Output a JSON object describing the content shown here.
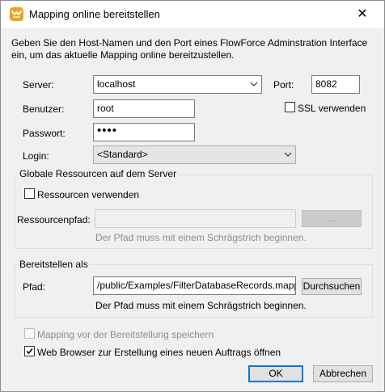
{
  "window": {
    "title": "Mapping online bereitstellen",
    "close_glyph": "✕",
    "icon": "mapforce-app-icon"
  },
  "intro": "Geben Sie den Host-Namen und den Port eines FlowForce Adminstration Interface ein, um das aktuelle Mapping online bereitzustellen.",
  "server": {
    "label": "Server:",
    "value": "localhost",
    "port_label": "Port:",
    "port_value": "8082"
  },
  "user": {
    "label": "Benutzer:",
    "value": "root",
    "ssl_label": "SSL verwenden",
    "ssl_checked": false
  },
  "password": {
    "label": "Passwort:",
    "masked_value": "••••"
  },
  "login": {
    "label": "Login:",
    "selected": "<Standard>"
  },
  "global_resources": {
    "title": "Globale Ressourcen auf dem Server",
    "use_label": "Ressourcen verwenden",
    "use_checked": false,
    "path_label": "Ressourcenpfad:",
    "path_value": "",
    "browse_label": "...",
    "hint": "Der Pfad muss mit einem Schrägstrich beginnen."
  },
  "deploy": {
    "title": "Bereitstellen als",
    "path_label": "Pfad:",
    "path_value": "/public/Examples/FilterDatabaseRecords.mapping",
    "browse_label": "Durchsuchen",
    "hint": "Der Pfad muss mit einem Schrägstrich beginnen."
  },
  "options": {
    "save_label": "Mapping vor der Bereitstellung speichern",
    "save_checked": false,
    "save_enabled": false,
    "browser_label": "Web Browser zur Erstellung eines neuen Auftrags öffnen",
    "browser_checked": true
  },
  "buttons": {
    "ok": "OK",
    "cancel": "Abbrechen"
  }
}
